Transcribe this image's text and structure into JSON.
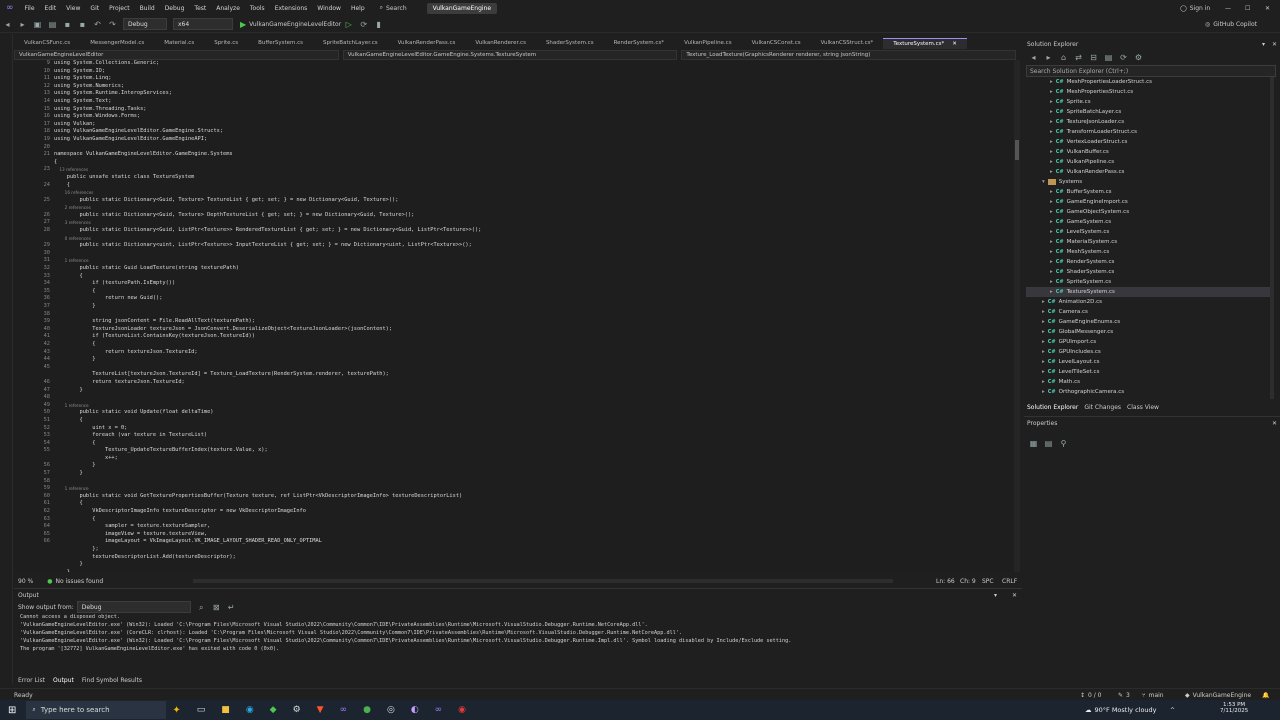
{
  "menubar": {
    "items": [
      "File",
      "Edit",
      "View",
      "Git",
      "Project",
      "Build",
      "Debug",
      "Test",
      "Analyze",
      "Tools",
      "Extensions",
      "Window",
      "Help"
    ],
    "search": "Search",
    "title": "VulkanGameEngine",
    "signin": "Sign in"
  },
  "toolbar": {
    "config": "Debug",
    "platform": "x64",
    "run_target": "VulkanGameEngineLevelEditor",
    "copilot": "GitHub Copilot"
  },
  "tabs": [
    "VulkanCSFunc.cs",
    "MessengerModel.cs",
    "Material.cs",
    "Sprite.cs",
    "BufferSystem.cs",
    "SpriteBatchLayer.cs",
    "VulkanRenderPass.cs",
    "VulkanRenderer.cs",
    "ShaderSystem.cs",
    "RenderSystem.cs*",
    "VulkanPipeline.cs",
    "VulkanCSConst.cs",
    "VulkanCSStruct.cs*",
    "TextureSystem.cs*"
  ],
  "navbar": {
    "project": "VulkanGameEngineLevelEditor",
    "class": "VulkanGameEngineLevelEditor.GameEngine.Systems.TextureSystem",
    "member": "Texture_LoadTexture(GraphicsRenderer renderer, string jsonString)"
  },
  "code": {
    "line_numbers": [
      "9",
      "10",
      "11",
      "12",
      "13",
      "14",
      "15",
      "16",
      "17",
      "18",
      "19",
      "20",
      "21",
      "",
      "23",
      "",
      "24",
      "",
      "25",
      "",
      "26",
      "27",
      "28",
      "",
      "29",
      "30",
      "31",
      "32",
      "33",
      "34",
      "35",
      "36",
      "37",
      "38",
      "39",
      "40",
      "41",
      "42",
      "43",
      "44",
      "45",
      "",
      "46",
      "47",
      "48",
      "49",
      "50",
      "51",
      "52",
      "53",
      "54",
      "55",
      "",
      "56",
      "57",
      "58",
      "59",
      "60",
      "61",
      "62",
      "63",
      "64",
      "65",
      "66"
    ],
    "lines": [
      "using System.Collections.Generic;",
      "using System.IO;",
      "using System.Linq;",
      "using System.Numerics;",
      "using System.Runtime.InteropServices;",
      "using System.Text;",
      "using System.Threading.Tasks;",
      "using System.Windows.Forms;",
      "using Vulkan;",
      "using VulkanGameEngineLevelEditor.GameEngine.Structs;",
      "using VulkanGameEngineLevelEditor.GameEngineAPI;",
      "",
      "namespace VulkanGameEngineLevelEditor.GameEngine.Systems",
      "{",
      "    13 references",
      "    public unsafe static class TextureSystem",
      "    {",
      "        16 references",
      "        public static Dictionary<Guid, Texture> TextureList { get; set; } = new Dictionary<Guid, Texture>();",
      "        2 references",
      "        public static Dictionary<Guid, Texture> DepthTextureList { get; set; } = new Dictionary<Guid, Texture>();",
      "        3 references",
      "        public static Dictionary<Guid, ListPtr<Texture>> RenderedTextureList { get; set; } = new Dictionary<Guid, ListPtr<Texture>>();",
      "        0 references",
      "        public static Dictionary<uint, ListPtr<Texture>> InputTextureList { get; set; } = new Dictionary<uint, ListPtr<Texture>>();",
      "",
      "        1 reference",
      "        public static Guid LoadTexture(string texturePath)",
      "        {",
      "            if (texturePath.IsEmpty())",
      "            {",
      "                return new Guid();",
      "            }",
      "",
      "            string jsonContent = File.ReadAllText(texturePath);",
      "            TextureJsonLoader textureJson = JsonConvert.DeserializeObject<TextureJsonLoader>(jsonContent);",
      "            if (TextureList.ContainsKey(textureJson.TextureId))",
      "            {",
      "                return textureJson.TextureId;",
      "            }",
      "",
      "            TextureList[textureJson.TextureId] = Texture_LoadTexture(RenderSystem.renderer, texturePath);",
      "            return textureJson.TextureId;",
      "        }",
      "",
      "        1 reference",
      "        public static void Update(float deltaTime)",
      "        {",
      "            uint x = 0;",
      "            foreach (var texture in TextureList)",
      "            {",
      "                Texture_UpdateTextureBufferIndex(texture.Value, x);",
      "                x++;",
      "            }",
      "        }",
      "",
      "        1 reference",
      "        public static void GetTexturePropertiesBuffer(Texture texture, ref ListPtr<VkDescriptorImageInfo> textureDescriptorList)",
      "        {",
      "            VkDescriptorImageInfo textureDescriptor = new VkDescriptorImageInfo",
      "            {",
      "                sampler = texture.textureSampler,",
      "                imageView = texture.textureView,",
      "                imageLayout = VkImageLayout.VK_IMAGE_LAYOUT_SHADER_READ_ONLY_OPTIMAL",
      "            };",
      "            textureDescriptorList.Add(textureDescriptor);",
      "        }",
      "    }"
    ]
  },
  "editor_status": {
    "zoom": "90 %",
    "issues": "No issues found",
    "ln": "Ln: 66",
    "ch": "Ch: 9",
    "spc": "SPC",
    "crlf": "CRLF"
  },
  "solution_explorer": {
    "title": "Solution Explorer",
    "search_placeholder": "Search Solution Explorer (Ctrl+;)",
    "items": [
      {
        "label": "MeshPropertiesLoaderStruct.cs",
        "type": "cs",
        "indent": 3
      },
      {
        "label": "MeshPropertiesStruct.cs",
        "type": "cs",
        "indent": 3
      },
      {
        "label": "Sprite.cs",
        "type": "cs",
        "indent": 3
      },
      {
        "label": "SpriteBatchLayer.cs",
        "type": "cs",
        "indent": 3
      },
      {
        "label": "TextureJsonLoader.cs",
        "type": "cs",
        "indent": 3
      },
      {
        "label": "TransformLoaderStruct.cs",
        "type": "cs",
        "indent": 3
      },
      {
        "label": "VertexLoaderStruct.cs",
        "type": "cs",
        "indent": 3
      },
      {
        "label": "VulkanBuffer.cs",
        "type": "cs",
        "indent": 3
      },
      {
        "label": "VulkanPipeline.cs",
        "type": "cs",
        "indent": 3
      },
      {
        "label": "VulkanRenderPass.cs",
        "type": "cs",
        "indent": 3
      },
      {
        "label": "Systems",
        "type": "folder",
        "indent": 2
      },
      {
        "label": "BufferSystem.cs",
        "type": "cs",
        "indent": 3
      },
      {
        "label": "GameEngineImport.cs",
        "type": "cs",
        "indent": 3
      },
      {
        "label": "GameObjectSystem.cs",
        "type": "cs",
        "indent": 3
      },
      {
        "label": "GameSystem.cs",
        "type": "cs",
        "indent": 3
      },
      {
        "label": "LevelSystem.cs",
        "type": "cs",
        "indent": 3
      },
      {
        "label": "MaterialSystem.cs",
        "type": "cs",
        "indent": 3
      },
      {
        "label": "MeshSystem.cs",
        "type": "cs",
        "indent": 3
      },
      {
        "label": "RenderSystem.cs",
        "type": "cs",
        "indent": 3
      },
      {
        "label": "ShaderSystem.cs",
        "type": "cs",
        "indent": 3
      },
      {
        "label": "SpriteSystem.cs",
        "type": "cs",
        "indent": 3
      },
      {
        "label": "TextureSystem.cs",
        "type": "cs",
        "indent": 3,
        "selected": true
      },
      {
        "label": "Animation2D.cs",
        "type": "cs",
        "indent": 2
      },
      {
        "label": "Camera.cs",
        "type": "cs",
        "indent": 2
      },
      {
        "label": "GameEngineEnums.cs",
        "type": "cs",
        "indent": 2
      },
      {
        "label": "GlobalMessenger.cs",
        "type": "cs",
        "indent": 2
      },
      {
        "label": "GPUImport.cs",
        "type": "cs",
        "indent": 2
      },
      {
        "label": "GPUIncludes.cs",
        "type": "cs",
        "indent": 2
      },
      {
        "label": "LevelLayout.cs",
        "type": "cs",
        "indent": 2
      },
      {
        "label": "LevelTileSet.cs",
        "type": "cs",
        "indent": 2
      },
      {
        "label": "Math.cs",
        "type": "cs",
        "indent": 2
      },
      {
        "label": "OrthographicCamera.cs",
        "type": "cs",
        "indent": 2
      }
    ],
    "tabs": [
      "Solution Explorer",
      "Git Changes",
      "Class View"
    ]
  },
  "properties": {
    "title": "Properties"
  },
  "output": {
    "title": "Output",
    "show_from_label": "Show output from:",
    "show_from_value": "Debug",
    "lines": [
      "Cannot access a disposed object.",
      "",
      "'VulkanGameEngineLevelEditor.exe' (Win32): Loaded 'C:\\Program Files\\Microsoft Visual Studio\\2022\\Community\\Common7\\IDE\\PrivateAssemblies\\Runtime\\Microsoft.VisualStudio.Debugger.Runtime.NetCoreApp.dll'.",
      "'VulkanGameEngineLevelEditor.exe' (CoreCLR: clrhost): Loaded 'C:\\Program Files\\Microsoft Visual Studio\\2022\\Community\\Common7\\IDE\\PrivateAssemblies\\Runtime\\Microsoft.VisualStudio.Debugger.Runtime.NetCoreApp.dll'.",
      "'VulkanGameEngineLevelEditor.exe' (Win32): Loaded 'C:\\Program Files\\Microsoft Visual Studio\\2022\\Community\\Common7\\IDE\\PrivateAssemblies\\Runtime\\Microsoft.VisualStudio.Debugger.Runtime.Impl.dll'. Symbol loading disabled by Include/Exclude setting.",
      "The program '[32772] VulkanGameEngineLevelEditor.exe' has exited with code 0 (0x0)."
    ],
    "bottom_tabs": [
      "Error List",
      "Output",
      "Find Symbol Results"
    ]
  },
  "statusbar": {
    "ready": "Ready",
    "errors": "0 / 0",
    "changes": "3",
    "branch": "main",
    "repo": "VulkanGameEngine"
  },
  "taskbar": {
    "search_placeholder": "Type here to search",
    "weather": "90°F  Mostly cloudy",
    "time": "1:53 PM",
    "date": "7/11/2025"
  }
}
